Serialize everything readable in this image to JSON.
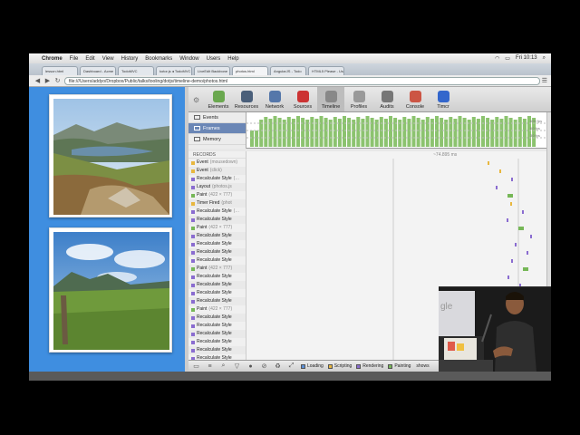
{
  "menubar": {
    "app": "Chrome",
    "items": [
      "File",
      "Edit",
      "View",
      "History",
      "Bookmarks",
      "Window",
      "Users",
      "Help"
    ],
    "clock": "Fri 10:13"
  },
  "tabs": [
    "lesson.html",
    "Dashboard - Acme",
    "TodoMVC",
    "kotor.js ◂ TodoMVC",
    "LiveEdit Backbone",
    "photos.html",
    "AngularJS - Todo",
    "HTML5 Please - Us"
  ],
  "address": {
    "url": "file:///Users/addyo/Dropbox/Public/talks/tooling/dotjs/timeline-demo/photos.html"
  },
  "devtools": {
    "panels": [
      {
        "label": "Elements",
        "icon": "elements-icon",
        "color": "#6aa84f"
      },
      {
        "label": "Resources",
        "icon": "resources-icon",
        "color": "#4a5f7a"
      },
      {
        "label": "Network",
        "icon": "network-icon",
        "color": "#5577aa"
      },
      {
        "label": "Sources",
        "icon": "sources-icon",
        "color": "#cc3333"
      },
      {
        "label": "Timeline",
        "icon": "timeline-icon",
        "color": "#888888"
      },
      {
        "label": "Profiles",
        "icon": "profiles-icon",
        "color": "#999999"
      },
      {
        "label": "Audits",
        "icon": "audits-icon",
        "color": "#777777"
      },
      {
        "label": "Console",
        "icon": "console-icon",
        "color": "#cc5544"
      },
      {
        "label": "Timcr",
        "icon": "timcr-icon",
        "color": "#3366cc"
      }
    ],
    "active_panel": "Timeline",
    "overview": [
      "Events",
      "Frames",
      "Memory"
    ],
    "selected_overview": "Frames",
    "overview_labels": [
      "600 fps",
      "60 fps",
      "30 fps"
    ],
    "records_header": "RECORDS",
    "records_time": "~74.895 ms",
    "records": [
      {
        "name": "Event",
        "detail": "(mousedown)",
        "type": "scripting"
      },
      {
        "name": "Event",
        "detail": "(click)",
        "type": "scripting"
      },
      {
        "name": "Recalculate Style",
        "detail": "(…",
        "type": "rendering"
      },
      {
        "name": "Layout",
        "detail": "(photos.js",
        "type": "rendering"
      },
      {
        "name": "Paint",
        "detail": "(422 × 777)",
        "type": "painting"
      },
      {
        "name": "Timer Fired",
        "detail": "(phot",
        "type": "scripting"
      },
      {
        "name": "Recalculate Style",
        "detail": "(…",
        "type": "rendering"
      },
      {
        "name": "Recalculate Style",
        "detail": "",
        "type": "rendering"
      },
      {
        "name": "Paint",
        "detail": "(422 × 777)",
        "type": "painting"
      },
      {
        "name": "Recalculate Style",
        "detail": "",
        "type": "rendering"
      },
      {
        "name": "Recalculate Style",
        "detail": "",
        "type": "rendering"
      },
      {
        "name": "Recalculate Style",
        "detail": "",
        "type": "rendering"
      },
      {
        "name": "Recalculate Style",
        "detail": "",
        "type": "rendering"
      },
      {
        "name": "Paint",
        "detail": "(422 × 777)",
        "type": "painting"
      },
      {
        "name": "Recalculate Style",
        "detail": "",
        "type": "rendering"
      },
      {
        "name": "Recalculate Style",
        "detail": "",
        "type": "rendering"
      },
      {
        "name": "Recalculate Style",
        "detail": "",
        "type": "rendering"
      },
      {
        "name": "Recalculate Style",
        "detail": "",
        "type": "rendering"
      },
      {
        "name": "Paint",
        "detail": "(422 × 777)",
        "type": "painting"
      },
      {
        "name": "Recalculate Style",
        "detail": "",
        "type": "rendering"
      },
      {
        "name": "Recalculate Style",
        "detail": "",
        "type": "rendering"
      },
      {
        "name": "Recalculate Style",
        "detail": "",
        "type": "rendering"
      },
      {
        "name": "Recalculate Style",
        "detail": "",
        "type": "rendering"
      },
      {
        "name": "Recalculate Style",
        "detail": "",
        "type": "rendering"
      },
      {
        "name": "Recalculate Style",
        "detail": "",
        "type": "rendering"
      }
    ],
    "legend": [
      {
        "label": "Loading",
        "color": "#5b8fd6"
      },
      {
        "label": "Scripting",
        "color": "#e8b73f"
      },
      {
        "label": "Rendering",
        "color": "#8a6cd0"
      },
      {
        "label": "Painting",
        "color": "#76b757"
      }
    ],
    "legend_tail": "shows"
  },
  "colors": {
    "page_bg": "#3f8ee0",
    "frame_bar": "#8cc36f",
    "selection": "#6b87b6"
  }
}
